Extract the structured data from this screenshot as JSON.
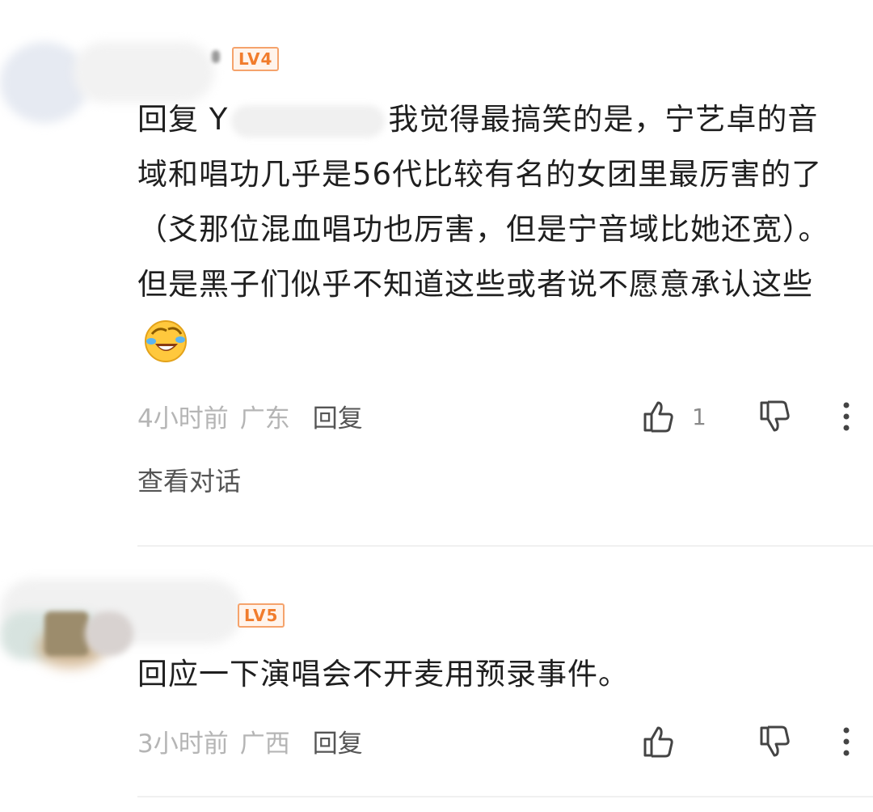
{
  "comments": [
    {
      "level": "LV4",
      "reply_prefix": "回复 Y",
      "text": "我觉得最搞笑的是，宁艺卓的音域和唱功几乎是56代比较有名的女团里最厉害的了（爻那位混血唱功也厉害，但是宁音域比她还宽）。但是黑子们似乎不知道这些或者说不愿意承认这些",
      "time": "4小时前",
      "location": "广东",
      "reply_label": "回复",
      "likes": "1",
      "view_conversation": "查看对话"
    },
    {
      "level": "LV5",
      "text": "回应一下演唱会不开麦用预录事件。",
      "time": "3小时前",
      "location": "广西",
      "reply_label": "回复"
    }
  ],
  "colors": {
    "badge": "#f17c2c",
    "meta": "#b5b5b5",
    "text": "#1f1f1f"
  }
}
